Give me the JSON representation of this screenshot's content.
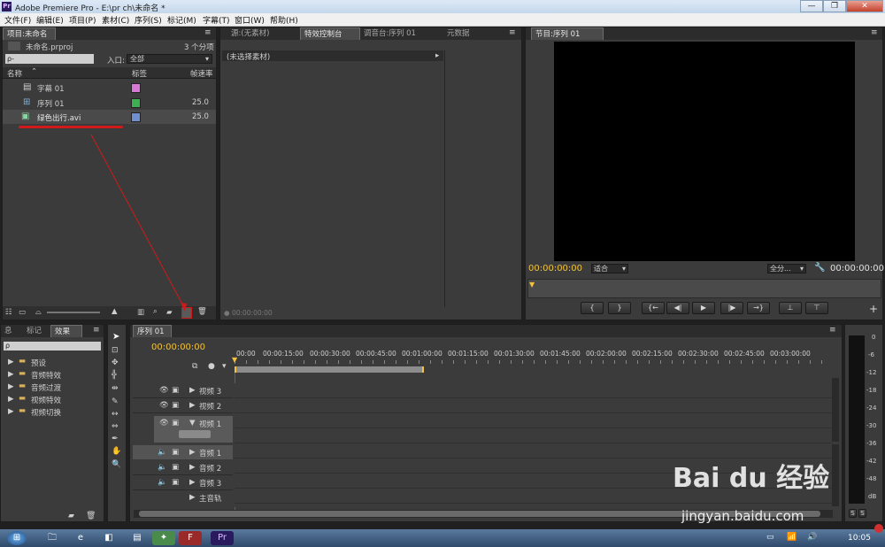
{
  "window": {
    "title": "Adobe Premiere Pro - E:\\pr ch\\未命名 *",
    "app_icon": "Pr"
  },
  "menu": [
    "文件(F)",
    "编辑(E)",
    "项目(P)",
    "素材(C)",
    "序列(S)",
    "标记(M)",
    "字幕(T)",
    "窗口(W)",
    "帮助(H)"
  ],
  "project": {
    "tab": "项目:未命名",
    "file": "未命名.prproj",
    "count": "3 个分项",
    "search_value": "ρ-",
    "inpoint_label": "入口:",
    "inpoint_value": "全部",
    "columns": [
      "名称",
      "标签",
      "帧速率"
    ],
    "items": [
      {
        "name": "字幕 01",
        "fps": "",
        "color": "#d777d7",
        "icon": "title-icon"
      },
      {
        "name": "序列 01",
        "fps": "25.0",
        "color": "#3fae53",
        "icon": "sequence-icon"
      },
      {
        "name": "绿色出行.avi",
        "fps": "25.0",
        "color": "#6f8fcf",
        "icon": "clip-icon"
      }
    ]
  },
  "source": {
    "tabs": [
      "源:(无素材)",
      "特效控制台",
      "调音台:序列 01",
      "元数据"
    ],
    "no_clip": "(未选择素材)",
    "timecode": "00:00:00:00"
  },
  "program": {
    "tab": "节目:序列 01",
    "timecode_left": "00:00:00:00",
    "fit": "适合",
    "quality": "全分...",
    "timecode_right": "00:00:00:00"
  },
  "effects": {
    "tabs": [
      "息",
      "标记",
      "效果"
    ],
    "search_value": "ρ",
    "folders": [
      "预设",
      "音频特效",
      "音频过渡",
      "视频特效",
      "视频切换"
    ]
  },
  "timeline": {
    "tab": "序列 01",
    "timecode": "00:00:00:00",
    "ruler": [
      "00:00",
      "00:00:15:00",
      "00:00:30:00",
      "00:00:45:00",
      "00:01:00:00",
      "00:01:15:00",
      "00:01:30:00",
      "00:01:45:00",
      "00:02:00:00",
      "00:02:15:00",
      "00:02:30:00",
      "00:02:45:00",
      "00:03:00:00"
    ],
    "tracks": [
      "视频 3",
      "视频 2",
      "视频 1",
      "音频 1",
      "音频 2",
      "音频 3",
      "主音轨"
    ]
  },
  "meter": {
    "labels": [
      "0",
      "-6",
      "-12",
      "-18",
      "-24",
      "-30",
      "-36",
      "-42",
      "-48",
      "dB"
    ],
    "solo_labels": [
      "S",
      "S"
    ]
  },
  "taskbar": {
    "time": "10:05"
  },
  "watermark": {
    "brand": "Bai du 经验",
    "url": "jingyan.baidu.com"
  },
  "colors": {
    "accent_yellow": "#f2c23a",
    "annotation_red": "#d01a1a",
    "playhead": "#d23030"
  }
}
